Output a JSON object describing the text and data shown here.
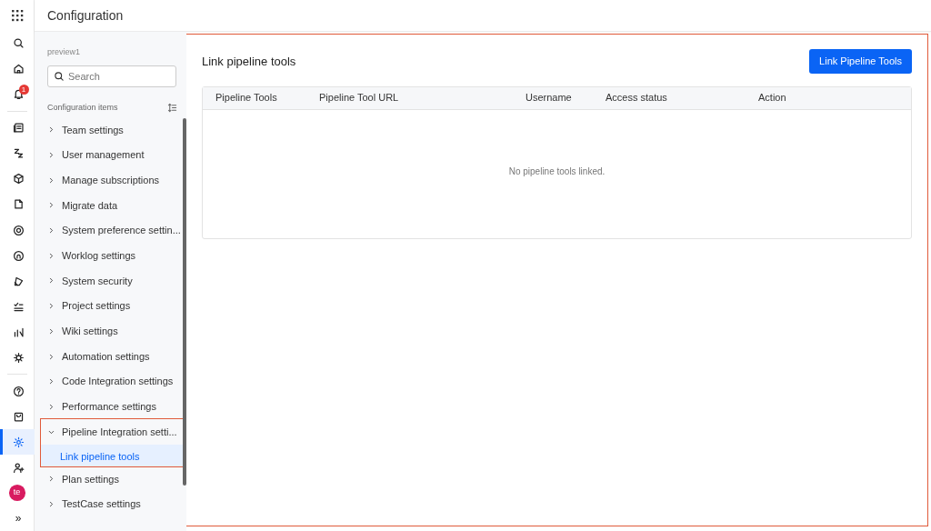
{
  "header": {
    "title": "Configuration"
  },
  "rail": {
    "items": [
      {
        "selected": false
      },
      {
        "selected": false
      },
      {
        "selected": false,
        "badge": "1"
      },
      {
        "selected": false
      },
      {
        "selected": false
      },
      {
        "selected": false
      },
      {
        "selected": false
      },
      {
        "selected": false
      },
      {
        "selected": false
      },
      {
        "selected": false
      },
      {
        "selected": false
      },
      {
        "selected": false
      },
      {
        "selected": false
      },
      {
        "selected": false
      },
      {
        "selected": false
      },
      {
        "selected": true
      },
      {
        "selected": false
      }
    ],
    "avatar": "te",
    "expand": "»"
  },
  "sidebar": {
    "workspace": "preview1",
    "search": {
      "placeholder": "Search"
    },
    "section_label": "Configuration items",
    "items": [
      {
        "label": "Team settings",
        "expanded": false
      },
      {
        "label": "User management",
        "expanded": false
      },
      {
        "label": "Manage subscriptions",
        "expanded": false
      },
      {
        "label": "Migrate data",
        "expanded": false
      },
      {
        "label": "System preference settin...",
        "expanded": false
      },
      {
        "label": "Worklog settings",
        "expanded": false
      },
      {
        "label": "System security",
        "expanded": false
      },
      {
        "label": "Project settings",
        "expanded": false
      },
      {
        "label": "Wiki settings",
        "expanded": false
      },
      {
        "label": "Automation settings",
        "expanded": false
      },
      {
        "label": "Code Integration settings",
        "expanded": false
      },
      {
        "label": "Performance settings",
        "expanded": false
      },
      {
        "label": "Pipeline Integration setti...",
        "expanded": true,
        "highlighted": true,
        "children": [
          {
            "label": "Link pipeline tools",
            "selected": true
          }
        ]
      },
      {
        "label": "Plan settings",
        "expanded": false
      },
      {
        "label": "TestCase settings",
        "expanded": false
      }
    ]
  },
  "main": {
    "highlighted": true,
    "title": "Link pipeline tools",
    "button": "Link Pipeline Tools",
    "table": {
      "columns": [
        "Pipeline Tools",
        "Pipeline Tool URL",
        "Username",
        "Access status",
        "Action"
      ],
      "empty_text": "No pipeline tools linked."
    }
  }
}
